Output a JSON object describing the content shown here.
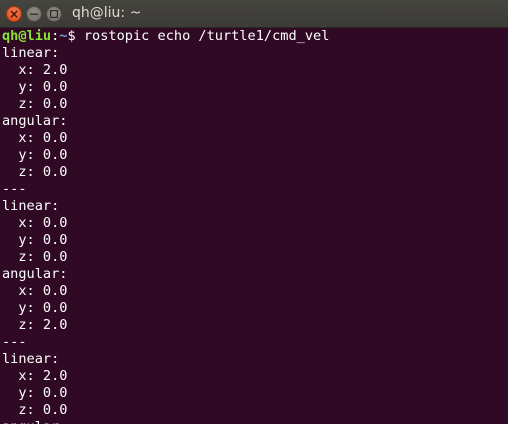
{
  "window": {
    "title": "qh@liu: ~",
    "close_glyph": "×",
    "minimize_glyph": "−"
  },
  "terminal": {
    "prompt": {
      "user_host": "qh@liu",
      "separator": ":",
      "path": "~",
      "symbol": "$ ",
      "command": "rostopic echo /turtle1/cmd_vel"
    },
    "output": [
      "linear:",
      "  x: 2.0",
      "  y: 0.0",
      "  z: 0.0",
      "angular:",
      "  x: 0.0",
      "  y: 0.0",
      "  z: 0.0",
      "---",
      "linear:",
      "  x: 0.0",
      "  y: 0.0",
      "  z: 0.0",
      "angular:",
      "  x: 0.0",
      "  y: 0.0",
      "  z: 2.0",
      "---",
      "linear:",
      "  x: 2.0",
      "  y: 0.0",
      "  z: 0.0",
      "angular:"
    ]
  },
  "colors": {
    "background": "#300a24",
    "prompt_user": "#8ae234",
    "prompt_path": "#729fcf",
    "text": "#ffffff",
    "close_button": "#dd4814"
  }
}
